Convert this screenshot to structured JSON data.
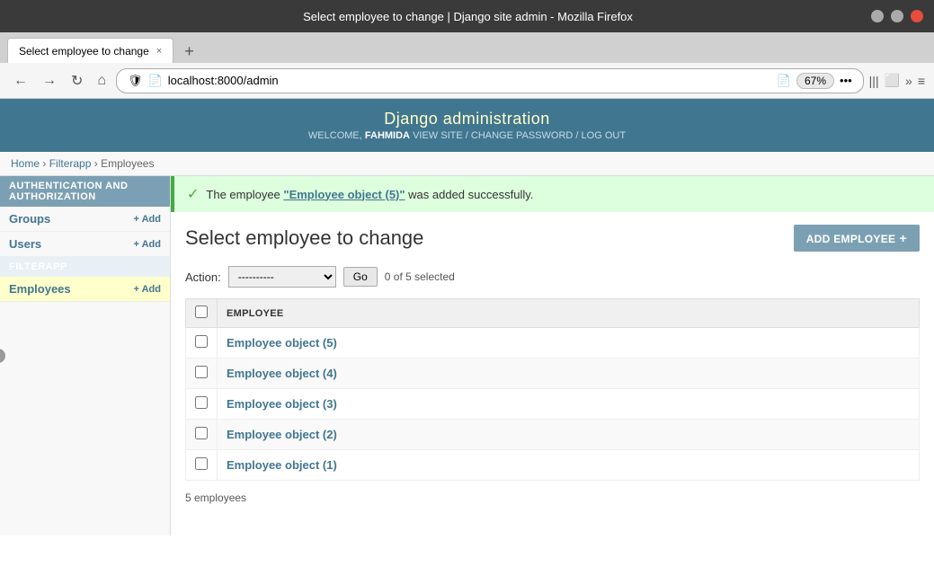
{
  "browser": {
    "titlebar": {
      "title": "Select employee to change | Django site admin - Mozilla Firefox"
    },
    "tab": {
      "label": "Select employee to change",
      "close_icon": "×"
    },
    "tab_new_icon": "+",
    "navbar": {
      "back_icon": "←",
      "forward_icon": "→",
      "refresh_icon": "↻",
      "home_icon": "⌂",
      "shield_icon": "🛡",
      "address": "localhost:8000/admin",
      "reader_icon": "📄",
      "zoom": "67%",
      "more_icon": "•••",
      "bookmarks_icon": "|||",
      "tabs_icon": "⬜",
      "overflow_icon": "»",
      "menu_icon": "≡"
    }
  },
  "django": {
    "header": {
      "title": "Django administration",
      "welcome_prefix": "WELCOME,",
      "username": "FAHMIDA",
      "view_site": "VIEW SITE",
      "separator1": "/",
      "change_password": "CHANGE PASSWORD",
      "separator2": "/",
      "log_out": "LOG OUT"
    },
    "breadcrumb": {
      "home": "Home",
      "separator1": "›",
      "filterapp": "Filterapp",
      "separator2": "›",
      "current": "Employees"
    },
    "sidebar": {
      "auth_section": "AUTHENTICATION AND AUTHORIZATION",
      "groups_label": "Groups",
      "groups_add": "+ Add",
      "users_label": "Users",
      "users_add": "+ Add",
      "filterapp_section": "FILTERAPP",
      "employees_label": "Employees",
      "employees_add": "+ Add",
      "collapse_icon": "«"
    },
    "success": {
      "icon": "✓",
      "message_prefix": "The employee ",
      "employee_name": "\"Employee object (5)\"",
      "message_suffix": " was added successfully."
    },
    "content": {
      "title": "Select employee to change",
      "add_button": "ADD EMPLOYEE",
      "action_label": "Action:",
      "action_placeholder": "----------",
      "go_button": "Go",
      "selected_text": "0 of 5 selected",
      "column_header": "EMPLOYEE",
      "employees": [
        {
          "id": 1,
          "label": "Employee object (5)"
        },
        {
          "id": 2,
          "label": "Employee object (4)"
        },
        {
          "id": 3,
          "label": "Employee object (3)"
        },
        {
          "id": 4,
          "label": "Employee object (2)"
        },
        {
          "id": 5,
          "label": "Employee object (1)"
        }
      ],
      "footer": "5 employees"
    }
  }
}
